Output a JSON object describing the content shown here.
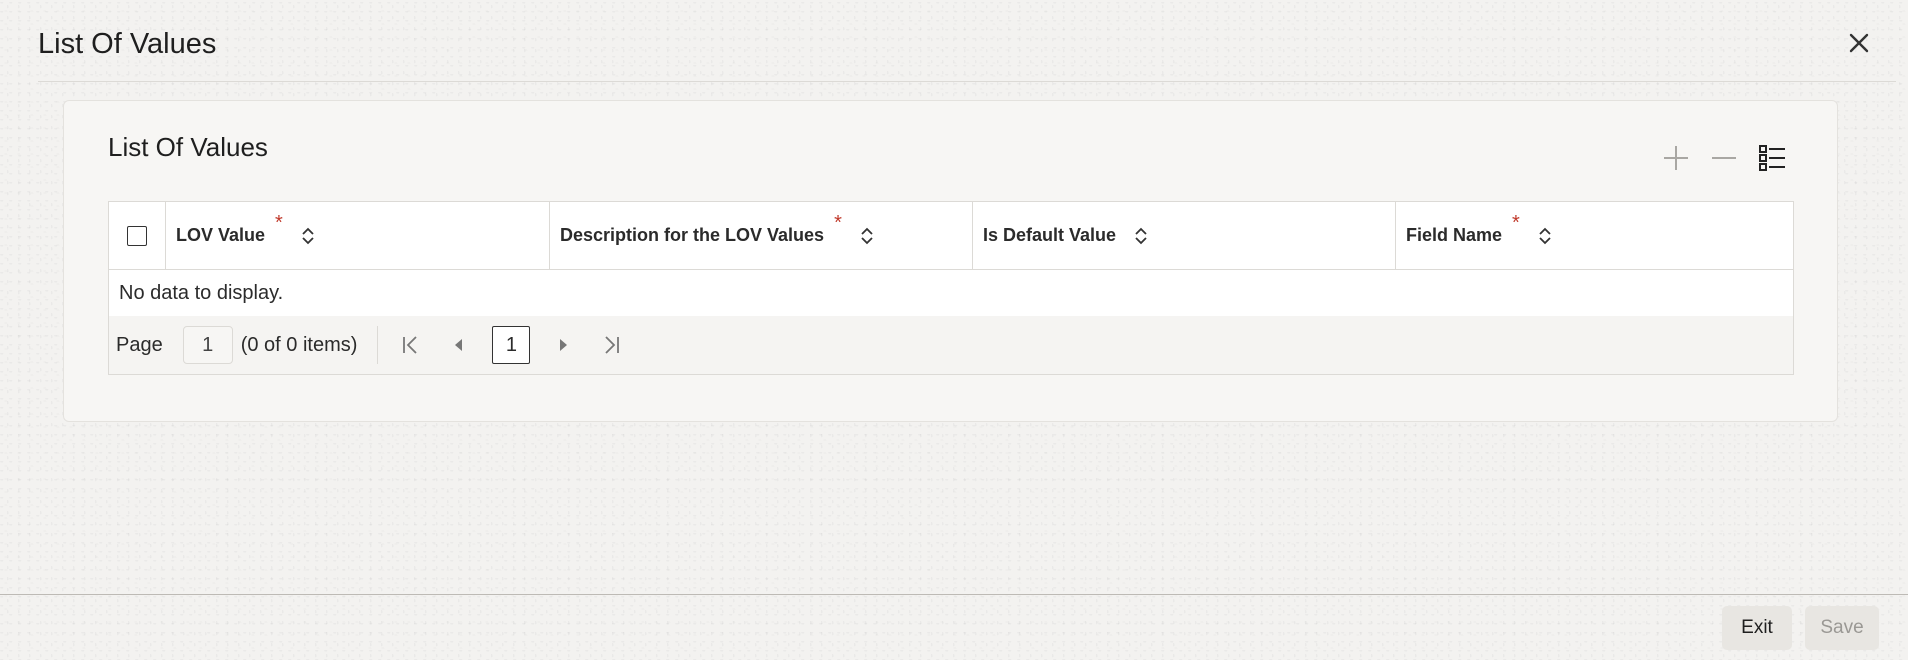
{
  "dialog": {
    "title": "List Of Values"
  },
  "panel": {
    "title": "List Of Values",
    "toolbar": {
      "add_icon": "plus-icon",
      "remove_icon": "minus-icon",
      "columns_icon": "list-columns-icon"
    }
  },
  "grid": {
    "columns": [
      {
        "label": "LOV Value",
        "required": "*"
      },
      {
        "label": "Description for the LOV Values",
        "required": "*"
      },
      {
        "label": "Is Default Value",
        "required": ""
      },
      {
        "label": "Field Name",
        "required": "*"
      }
    ],
    "empty_message": "No data to display."
  },
  "pager": {
    "page_label": "Page",
    "page_input_value": "1",
    "items_summary": "(0 of 0 items)",
    "current_page": "1"
  },
  "footer": {
    "exit_label": "Exit",
    "save_label": "Save"
  },
  "colors": {
    "required_marker": "#c0392b",
    "background": "#f3f2f0",
    "disabled_text": "#9a9894"
  }
}
